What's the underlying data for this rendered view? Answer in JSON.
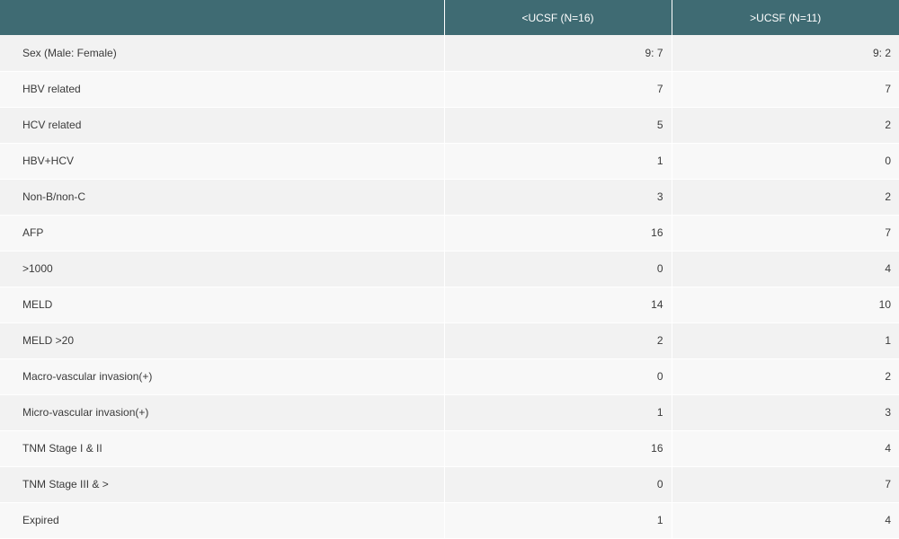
{
  "table": {
    "headers": [
      "",
      "<UCSF (N=16)",
      ">UCSF (N=11)"
    ],
    "rows": [
      {
        "label": "Sex (Male: Female)",
        "lt": "9: 7",
        "gt": "9: 2"
      },
      {
        "label": "HBV related",
        "lt": "7",
        "gt": "7"
      },
      {
        "label": "HCV related",
        "lt": "5",
        "gt": "2"
      },
      {
        "label": "HBV+HCV",
        "lt": "1",
        "gt": "0"
      },
      {
        "label": "Non-B/non-C",
        "lt": "3",
        "gt": "2"
      },
      {
        "label": "AFP",
        "lt": "16",
        "gt": "7"
      },
      {
        "label": ">1000",
        "lt": "0",
        "gt": "4"
      },
      {
        "label": "MELD",
        "lt": "14",
        "gt": "10"
      },
      {
        "label": "MELD >20",
        "lt": "2",
        "gt": "1"
      },
      {
        "label": "Macro-vascular invasion(+)",
        "lt": "0",
        "gt": "2"
      },
      {
        "label": "Micro-vascular invasion(+)",
        "lt": "1",
        "gt": "3"
      },
      {
        "label": "TNM Stage I & II",
        "lt": "16",
        "gt": "4"
      },
      {
        "label": "TNM Stage III & >",
        "lt": "0",
        "gt": "7"
      },
      {
        "label": "Expired",
        "lt": "1",
        "gt": "4"
      }
    ]
  },
  "colors": {
    "header_bg": "#3f6b73",
    "header_text": "#ffffff",
    "row_odd": "#f2f2f2",
    "row_even": "#f8f8f8",
    "body_text": "#3a3a3a"
  }
}
